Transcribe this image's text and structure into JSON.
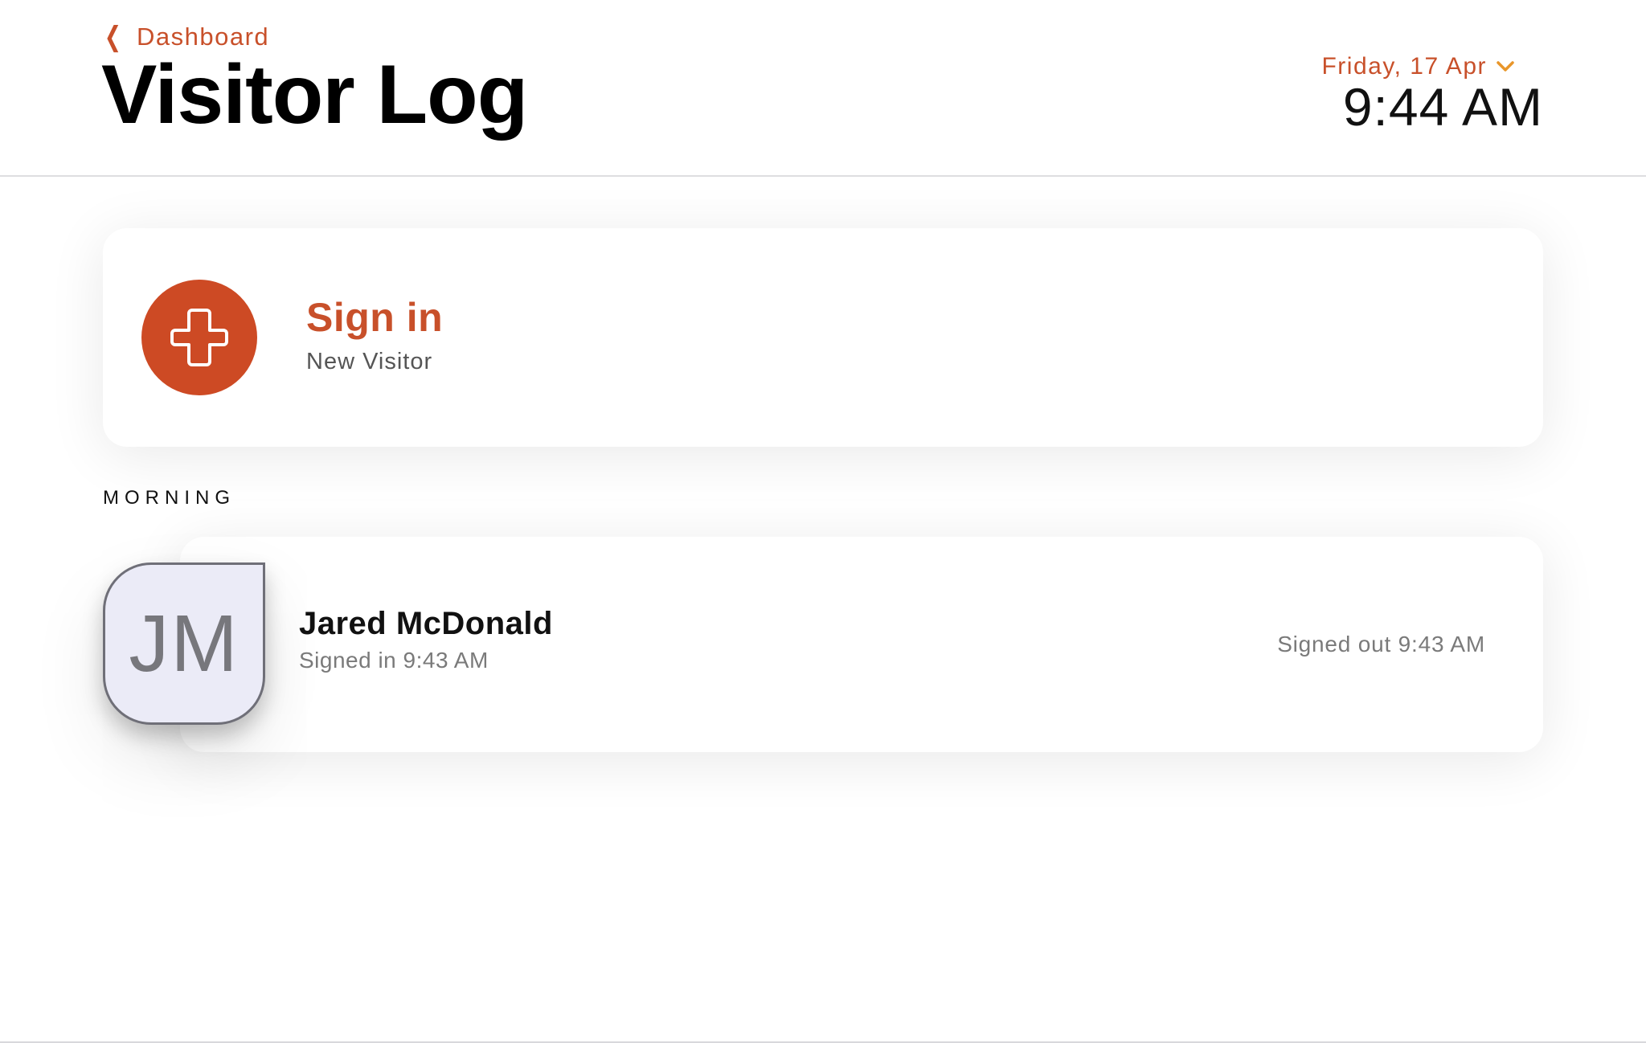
{
  "header": {
    "back_label": "Dashboard",
    "title": "Visitor Log",
    "date_label": "Friday, 17 Apr",
    "time": "9:44 AM"
  },
  "sign_in_card": {
    "title": "Sign in",
    "subtitle": "New Visitor",
    "icon": "plus-icon"
  },
  "sections": [
    {
      "label": "MORNING",
      "visitors": [
        {
          "initials": "JM",
          "name": "Jared McDonald",
          "signed_in": "Signed in 9:43 AM",
          "signed_out": "Signed out 9:43 AM"
        }
      ]
    }
  ],
  "colors": {
    "accent": "#c8502a",
    "accent_fill": "#cd4a24",
    "date_chevron": "#e8962a",
    "avatar_bg": "#ebebf7"
  }
}
